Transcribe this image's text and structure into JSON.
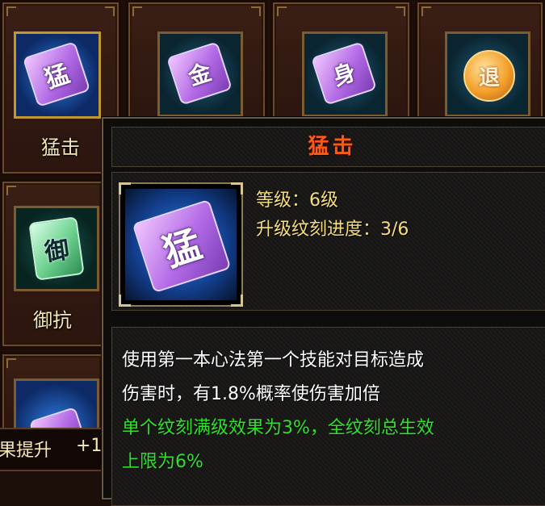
{
  "skills": [
    {
      "label": "猛击",
      "glyph": "猛",
      "style": "purple",
      "selected": true
    },
    {
      "label": "",
      "glyph": "金",
      "style": "purple",
      "selected": false
    },
    {
      "label": "",
      "glyph": "身",
      "style": "purple",
      "selected": false
    },
    {
      "label": "",
      "glyph": "退",
      "style": "orange",
      "selected": false
    },
    {
      "label": "御抗",
      "glyph": "御",
      "style": "green",
      "selected": false
    },
    {
      "label": "",
      "glyph": "",
      "style": "purple",
      "selected": false
    }
  ],
  "bottom_strip": {
    "left_text": "果提升",
    "right_text": "+1"
  },
  "tooltip": {
    "title": "猛击",
    "icon_glyph": "猛",
    "level_line": "等级：6级",
    "progress_line": "升级纹刻进度：3/6",
    "description": [
      "使用第一本心法第一个技能对目标造成",
      "伤害时，有1.8%概率使伤害加倍"
    ],
    "bonus": [
      "单个纹刻满级效果为3%，全纹刻总生效",
      "上限为6%"
    ]
  },
  "colors": {
    "title": "#ff5a14",
    "stat_text": "#f6de7a",
    "description_text": "#ffffff",
    "bonus_text": "#2fe22a",
    "selected_frame": "#c0982f"
  }
}
